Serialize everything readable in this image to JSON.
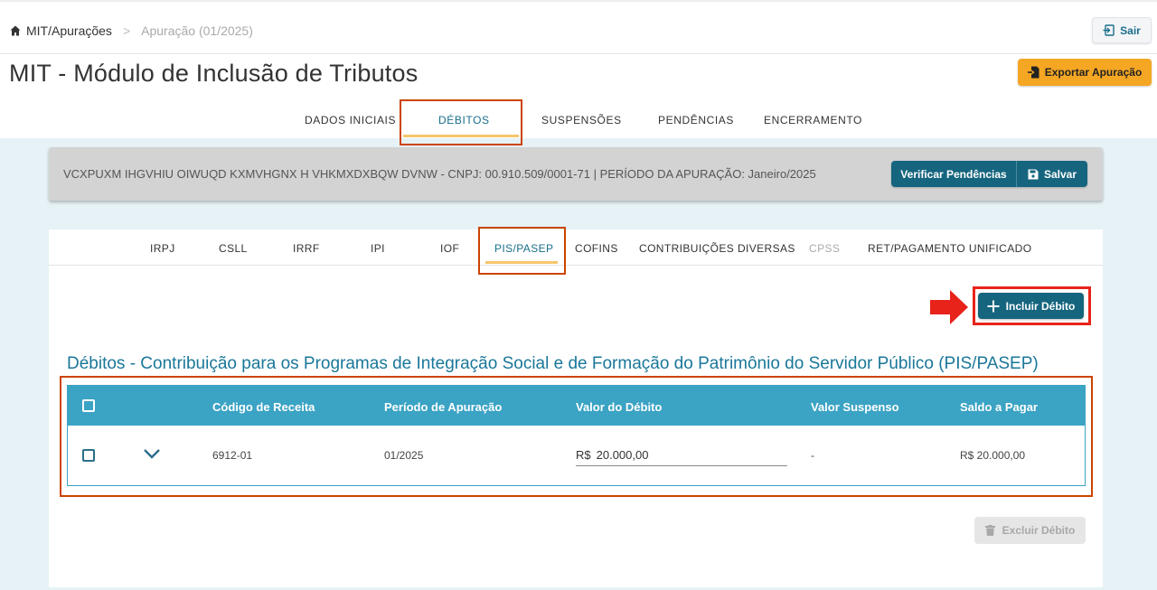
{
  "breadcrumb": {
    "home": "MIT/Apurações",
    "separator": ">",
    "current": "Apuração (01/2025)"
  },
  "header": {
    "exit_label": "Sair",
    "title": "MIT - Módulo de Inclusão de Tributos",
    "export_label": "Exportar Apuração"
  },
  "main_tabs": [
    {
      "label": "DADOS INICIAIS"
    },
    {
      "label": "DÉBITOS"
    },
    {
      "label": "SUSPENSÕES"
    },
    {
      "label": "PENDÊNCIAS"
    },
    {
      "label": "ENCERRAMENTO"
    }
  ],
  "info_bar": {
    "text": "VCXPUXM IHGVHIU OIWUQD KXMVHGNX H VHKMXDXBQW DVNW - CNPJ: 00.910.509/0001-71   |   PERÍODO DA APURAÇÃO: Janeiro/2025",
    "verify_label": "Verificar Pendências",
    "save_label": "Salvar"
  },
  "sub_tabs": [
    {
      "label": "IRPJ"
    },
    {
      "label": "CSLL"
    },
    {
      "label": "IRRF"
    },
    {
      "label": "IPI"
    },
    {
      "label": "IOF"
    },
    {
      "label": "PIS/PASEP"
    },
    {
      "label": "COFINS"
    },
    {
      "label": "CONTRIBUIÇÕES DIVERSAS"
    },
    {
      "label": "CPSS"
    },
    {
      "label": "RET/PAGAMENTO UNIFICADO"
    }
  ],
  "include_label": "Incluir Débito",
  "section_title": "Débitos - Contribuição para os Programas de Integração Social e de Formação do Patrimônio do Servidor Público (PIS/PASEP)",
  "table": {
    "headers": [
      "Código de Receita",
      "Período de Apuração",
      "Valor do Débito",
      "Valor Suspenso",
      "Saldo a Pagar"
    ],
    "rows": [
      {
        "codigo": "6912-01",
        "periodo": "01/2025",
        "currency": "R$",
        "valor": "20.000,00",
        "suspenso": "-",
        "saldo": "R$ 20.000,00"
      }
    ]
  },
  "delete_label": "Excluir Débito",
  "colors": {
    "primary": "#16657f",
    "table_header": "#3ba3c4",
    "accent": "#f5a623",
    "highlight": "#cc4400",
    "arrow": "#e8231a"
  }
}
